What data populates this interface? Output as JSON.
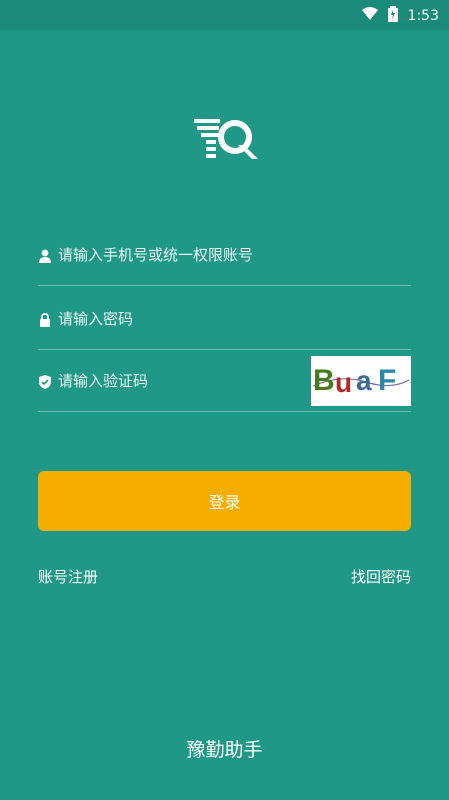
{
  "status_bar": {
    "time": "1:53"
  },
  "icons": {
    "wifi": "wifi-icon",
    "battery": "battery-icon",
    "user": "user-icon",
    "lock": "lock-icon",
    "shield": "shield-icon",
    "logo": "app-logo-icon"
  },
  "form": {
    "phone_placeholder": "请输入手机号或统一权限账号",
    "password_placeholder": "请输入密码",
    "captcha_placeholder": "请输入验证码",
    "captcha_text": "BuaF"
  },
  "buttons": {
    "login_label": "登录"
  },
  "links": {
    "register_label": "账号注册",
    "forgot_label": "找回密码"
  },
  "footer": {
    "app_name": "豫勤助手"
  },
  "colors": {
    "background": "#1f9887",
    "status_bar": "#1a8a7a",
    "button": "#f5ae00",
    "text": "#ffffff"
  }
}
